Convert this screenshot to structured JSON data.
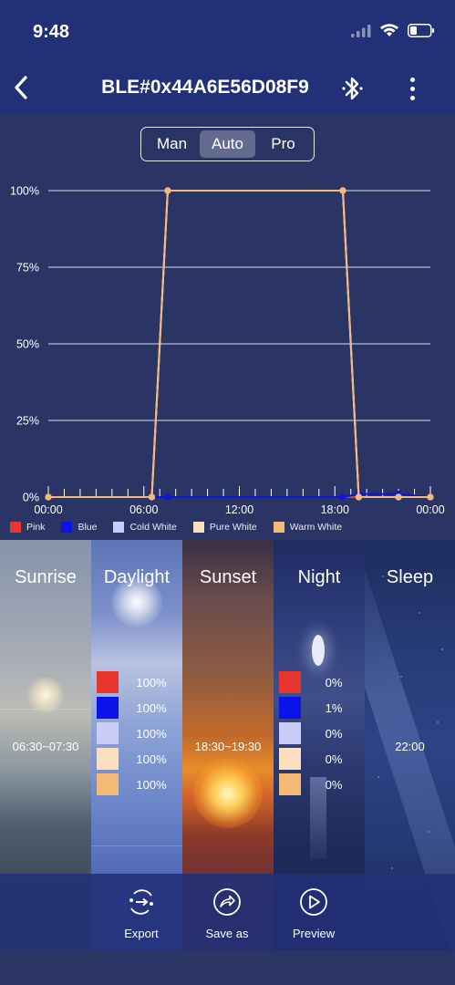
{
  "status": {
    "time": "9:48"
  },
  "nav": {
    "title": "BLE#0x44A6E56D08F9"
  },
  "mode_tabs": [
    {
      "label": "Man",
      "active": false
    },
    {
      "label": "Auto",
      "active": true
    },
    {
      "label": "Pro",
      "active": false
    }
  ],
  "chart_data": {
    "type": "line",
    "x_tick_labels": [
      "00:00",
      "06:00",
      "12:00",
      "18:00",
      "00:00"
    ],
    "y_tick_labels": [
      "0%",
      "25%",
      "50%",
      "75%",
      "100%"
    ],
    "xlim": [
      0,
      24
    ],
    "ylim": [
      0,
      100
    ],
    "grid": true,
    "legend_position": "bottom-left",
    "series": [
      {
        "name": "Pink",
        "color": "#e8352e",
        "x": [
          0,
          6.5,
          7.5,
          18.5,
          19.5,
          22,
          24
        ],
        "y": [
          0,
          0,
          0,
          0,
          0,
          0,
          0
        ]
      },
      {
        "name": "Blue",
        "color": "#0a14e8",
        "x": [
          0,
          6.5,
          7.5,
          18.5,
          19.5,
          22,
          24
        ],
        "y": [
          0,
          0,
          0,
          0,
          1,
          1,
          0
        ]
      },
      {
        "name": "Cold White",
        "color": "#c9cdf7",
        "x": [
          0,
          6.5,
          7.5,
          18.5,
          19.5,
          22,
          24
        ],
        "y": [
          0,
          0,
          100,
          100,
          0,
          0,
          0
        ]
      },
      {
        "name": "Pure White",
        "color": "#fbdfc0",
        "x": [
          0,
          6.5,
          7.5,
          18.5,
          19.5,
          22,
          24
        ],
        "y": [
          0,
          0,
          100,
          100,
          0,
          0,
          0
        ]
      },
      {
        "name": "Warm White",
        "color": "#f4b877",
        "x": [
          0,
          6.5,
          7.5,
          18.5,
          19.5,
          22,
          24
        ],
        "y": [
          0,
          0,
          100,
          100,
          0,
          0,
          0
        ]
      }
    ]
  },
  "scenes": [
    {
      "name": "Sunrise",
      "time": "06:30~07:30"
    },
    {
      "name": "Daylight",
      "levels": [
        "100%",
        "100%",
        "100%",
        "100%",
        "100%"
      ]
    },
    {
      "name": "Sunset",
      "time": "18:30~19:30"
    },
    {
      "name": "Night",
      "levels": [
        "0%",
        "1%",
        "0%",
        "0%",
        "0%"
      ]
    },
    {
      "name": "Sleep",
      "time": "22:00"
    }
  ],
  "actions": {
    "export": "Export",
    "save_as": "Save as",
    "preview": "Preview"
  },
  "icons": {
    "back": "back-chevron-icon",
    "bluetooth": "bluetooth-icon",
    "more": "more-vertical-icon",
    "export": "export-icon",
    "save_as": "share-icon",
    "preview": "play-icon"
  }
}
